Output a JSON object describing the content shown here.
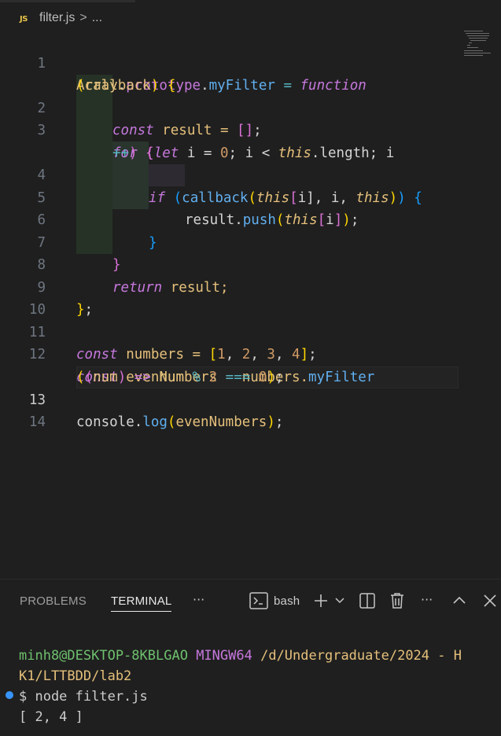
{
  "breadcrumb": {
    "file_badge": "JS",
    "file_name": "filter.js",
    "separator": ">",
    "ellipsis": "..."
  },
  "editor": {
    "line_numbers": [
      "1",
      "2",
      "3",
      "4",
      "5",
      "6",
      "7",
      "8",
      "9",
      "10",
      "11",
      "12",
      "13",
      "14"
    ],
    "code": {
      "l1a": [
        "Array",
        ".",
        "prototype",
        ".",
        "myFilter",
        " = ",
        "function"
      ],
      "l1b": [
        "(",
        "callback",
        ") ",
        "{"
      ],
      "l2": [
        "const",
        " result = ",
        "[]",
        ";"
      ],
      "l3a": [
        "for",
        " ",
        "(",
        "let",
        " i = ",
        "0",
        "; i < ",
        "this",
        ".length; i"
      ],
      "l3b": [
        "++",
        ") ",
        "{"
      ],
      "l4": [
        "if",
        " ",
        "(",
        "callback",
        "(",
        "this",
        "[",
        "i",
        "], i, ",
        "this",
        ")",
        ") ",
        "{"
      ],
      "l5": [
        "result.",
        "push",
        "(",
        "this",
        "[",
        "i",
        "]",
        ")",
        ";"
      ],
      "l6": [
        "}"
      ],
      "l7": [
        "}"
      ],
      "l8": [
        "return",
        " result;"
      ],
      "l9": [
        "}",
        ";"
      ],
      "l11": [
        "const",
        " numbers = ",
        "[",
        "1",
        ", ",
        "2",
        ", ",
        "3",
        ", ",
        "4",
        "]",
        ";"
      ],
      "l12a": [
        "const",
        " evenNumbers = numbers.",
        "myFilter"
      ],
      "l12b": [
        "(",
        "(",
        "num",
        ") ",
        "=>",
        " num ",
        "%",
        " ",
        "2",
        " ",
        "===",
        " ",
        "0",
        ")",
        ";"
      ],
      "l13": [
        "console.",
        "log",
        "(",
        "evenNumbers",
        ")",
        ";"
      ]
    }
  },
  "panel": {
    "tab_problems": "PROBLEMS",
    "tab_terminal": "TERMINAL",
    "more": "···",
    "shell": "bash",
    "terminal": {
      "user_host": "minh8@DESKTOP-8KBLGAO",
      "env": "MINGW64",
      "path_line1": "/d/Undergraduate/2024 - H",
      "path_line2": "K1/LTTBDD/lab2",
      "prompt": "$ node filter.js",
      "output": "[ 2, 4 ]"
    }
  }
}
